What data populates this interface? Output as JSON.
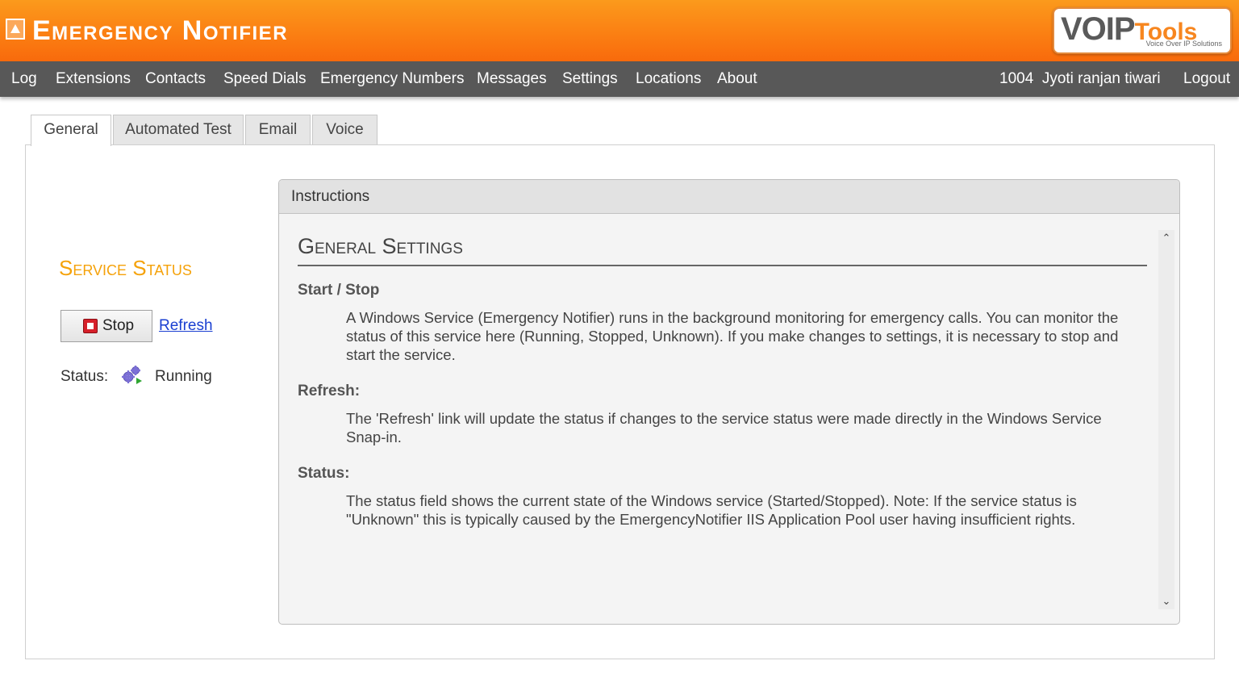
{
  "header": {
    "title": "Emergency Notifier",
    "logo": {
      "brand_main": "VOIP",
      "brand_tools": "Tools",
      "tagline": "Voice Over IP Solutions"
    }
  },
  "nav": {
    "items": [
      "Log",
      "Extensions",
      "Contacts",
      "Speed Dials",
      "Emergency Numbers",
      "Messages",
      "Settings",
      "Locations",
      "About"
    ],
    "user": "1004  Jyoti ranjan tiwari",
    "logout": "Logout"
  },
  "tabs": [
    "General",
    "Automated Test",
    "Email",
    "Voice"
  ],
  "active_tab": "General",
  "service": {
    "title": "Service Status",
    "stop_label": "Stop",
    "refresh_label": "Refresh",
    "status_label": "Status:",
    "status_value": "Running"
  },
  "instructions": {
    "header": "Instructions",
    "title": "General Settings",
    "sections": [
      {
        "heading": "Start / Stop",
        "text": "A Windows Service (Emergency Notifier) runs in the background monitoring for emergency calls. You can monitor the status of this service here (Running, Stopped, Unknown). If you make changes to settings, it is necessary to stop and start the service."
      },
      {
        "heading": "Refresh:",
        "text": "The 'Refresh' link will update the status if changes to the service status were made directly in the Windows Service Snap-in."
      },
      {
        "heading": "Status:",
        "text": "The status field shows the current state of the Windows service (Started/Stopped). Note: If the service status is \"Unknown\" this is typically caused by the EmergencyNotifier IIS Application Pool user having insufficient rights."
      }
    ]
  },
  "colors": {
    "header_orange": "#fb7d12",
    "nav_bg": "#585858",
    "service_title": "#f5a20a",
    "link": "#1a3fd1",
    "stop_red": "#d6202a"
  }
}
